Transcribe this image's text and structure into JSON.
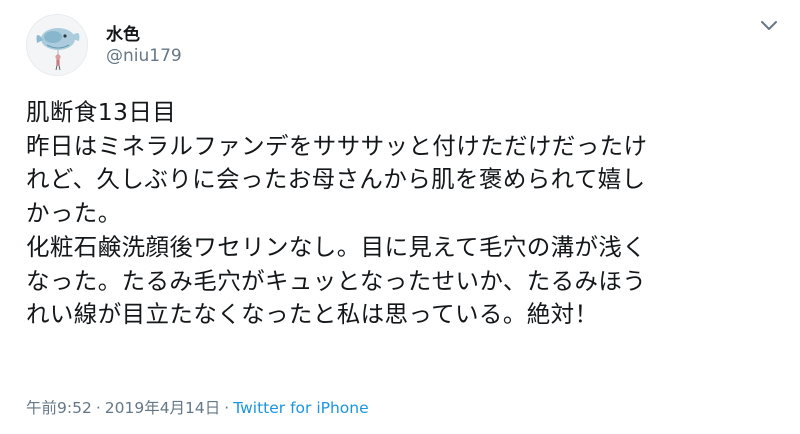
{
  "author": {
    "display_name": "水色",
    "handle": "@niu179"
  },
  "tweet": {
    "lines": [
      "肌断食13日目",
      "昨日はミネラルファンデをサササッと付けただけだったけ",
      "れど、久しぶりに会ったお母さんから肌を褒められて嬉し",
      "かった。",
      "化粧石鹸洗顔後ワセリンなし。目に見えて毛穴の溝が浅く",
      "なった。たるみ毛穴がキュッとなったせいか、たるみほう",
      "れい線が目立たなくなったと私は思っている。絶対！"
    ]
  },
  "meta": {
    "time": "午前9:52",
    "separator": "·",
    "date": "2019年4月14日",
    "separator2": "·",
    "source": "Twitter for iPhone"
  },
  "colors": {
    "text": "#14171a",
    "secondary": "#657786",
    "link": "#1b95e0"
  },
  "icons": {
    "caret": "chevron-down-icon",
    "avatar": "avatar"
  }
}
